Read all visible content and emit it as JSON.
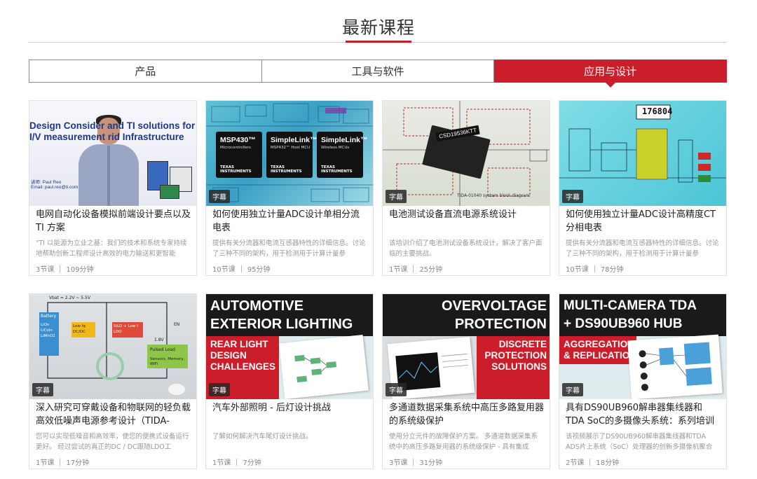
{
  "section": {
    "title": "最新课程"
  },
  "tabs": [
    {
      "label": "产品",
      "active": false
    },
    {
      "label": "工具与软件",
      "active": false
    },
    {
      "label": "应用与设计",
      "active": true
    }
  ],
  "cards": [
    {
      "title": "电网自动化设备模拟前端设计要点以及 TI 方案",
      "desc": "\"TI 以能源为立业之基：我们的技术和系统专家持续地帮助创新工程师设计高效的电力输送和更智能",
      "lessons": "3节课",
      "duration": "109分钟",
      "badge": "",
      "thumb": {
        "line1": "Design Consider     and TI solutions for",
        "line2": "I/V measurement     rid Infrastructure",
        "presenter": "讲师: Paul Reo",
        "email": "Email: paul.reo@ti.com"
      }
    },
    {
      "title": "如何使用独立计量ADC设计单相分流电表",
      "desc": "提供有关分流器和电流互感器特性的详细信息。讨论了三种不同的架构，用于检测用于计算计量参",
      "lessons": "10节课",
      "duration": "95分钟",
      "badge": "字幕",
      "thumb": {
        "chips": [
          {
            "name": "MSP430™",
            "sub": "Microcontrollers"
          },
          {
            "name": "SimpleLink™",
            "sub": "MSP432™ Host MCU"
          },
          {
            "name": "SimpleLink™",
            "sub": "Wireless MCUs"
          }
        ],
        "brand": "TEXAS INSTRUMENTS"
      }
    },
    {
      "title": "电池测试设备直流电源系统设计",
      "desc": "该培训介绍了电池测试设备系统设计，解决了客户面临的主要挑战。",
      "lessons": "1节课",
      "duration": "25分钟",
      "badge": "字幕",
      "thumb": {
        "chip_label": "CSD19536KTT",
        "caption": "TIDA-01040 system block diagram"
      }
    },
    {
      "title": "如何使用独立计量ADC设计高精度CT分相电表",
      "desc": "提供有关分流器和电流互感器特性的详细信息。讨论了三种不同的架构，用于检测用于计算计量参",
      "lessons": "10节课",
      "duration": "78分钟",
      "badge": "字幕",
      "thumb": {
        "readout": "176804"
      }
    },
    {
      "title": "深入研究可穿戴设备和物联网的轻负载高效低噪声电源参考设计（TIDA-",
      "desc": "您可以实现低噪音和高效率，使您的便携式设备运行更好。 经过尝试的真正的DC / DC跟随LDO工",
      "lessons": "1节课",
      "duration": "17分钟",
      "badge": "字幕",
      "thumb": {
        "vin": "Vbat = 2.2V ~ 5.5V",
        "battery": "Battery",
        "cells": "LiOn\nLiCoIn\nLiMnO2",
        "buck": "Low Iq DC/DC",
        "ldo": "SILD + Low I LDO",
        "v18": "1.8V",
        "load": "Pulsed Load",
        "sensors": "Sensors, Memory, WiFi",
        "en": "EN"
      }
    },
    {
      "title": "汽车外部照明 - 后灯设计挑战",
      "desc": "了解如何解决汽车尾灯设计挑战。",
      "lessons": "1节课",
      "duration": "7分钟",
      "badge": "字幕",
      "thumb": {
        "line1": "AUTOMOTIVE",
        "line2": "EXTERIOR LIGHTING",
        "sub": [
          "REAR LIGHT",
          "DESIGN",
          "CHALLENGES"
        ]
      }
    },
    {
      "title": "多通道数据采集系统中高压多路复用器的系统级保护",
      "desc": "使用分立元件的故障保护方案。 多通道数据采集系统中的高压多路复用器的系统级保护 - 具有集成",
      "lessons": "3节课",
      "duration": "31分钟",
      "badge": "字幕",
      "thumb": {
        "line1": "OVERVOLTAGE",
        "line2": "PROTECTION",
        "sub": [
          "DISCRETE",
          "PROTECTION",
          "SOLUTIONS"
        ]
      }
    },
    {
      "title": "具有DS90UB960解串器集线器和TDA SoC的多摄像头系统：系列培训",
      "desc": "该视频展示了DS90UB960解串器集线器和TDA ADS片上系统（SoC）处理器的创新多摄像机聚合",
      "lessons": "2节课",
      "duration": "18分钟",
      "badge": "字幕",
      "thumb": {
        "line1": "MULTI-CAMERA TDA",
        "line2": "+ DS90UB960 HUB",
        "sub": [
          "AGGREGATION",
          "& REPLICATION"
        ]
      }
    }
  ],
  "colors": {
    "accent": "#cc1e2a",
    "border": "#e2e2e2",
    "muted": "#999999"
  }
}
